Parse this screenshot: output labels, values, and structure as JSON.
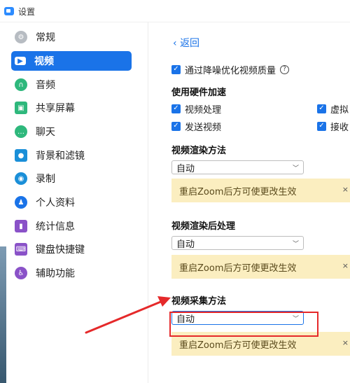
{
  "window": {
    "title": "设置"
  },
  "sidebar": {
    "items": [
      {
        "label": "常规",
        "icon": "gear-icon",
        "color": "#b7bcc2"
      },
      {
        "label": "视频",
        "icon": "video-camera-icon",
        "color": "#ffffff",
        "active": true
      },
      {
        "label": "音频",
        "icon": "headphones-icon",
        "color": "#2eb87c"
      },
      {
        "label": "共享屏幕",
        "icon": "share-screen-icon",
        "color": "#2eb87c"
      },
      {
        "label": "聊天",
        "icon": "chat-bubble-icon",
        "color": "#2eb87c"
      },
      {
        "label": "背景和滤镜",
        "icon": "portrait-icon",
        "color": "#1a8fd8"
      },
      {
        "label": "录制",
        "icon": "record-icon",
        "color": "#1a8fd8"
      },
      {
        "label": "个人资料",
        "icon": "user-icon",
        "color": "#1a73e8"
      },
      {
        "label": "统计信息",
        "icon": "bar-chart-icon",
        "color": "#8a52c8"
      },
      {
        "label": "键盘快捷键",
        "icon": "keyboard-icon",
        "color": "#8a52c8"
      },
      {
        "label": "辅助功能",
        "icon": "accessibility-icon",
        "color": "#8a52c8"
      }
    ]
  },
  "main": {
    "back_label": "返回",
    "denoise": {
      "label": "通过降噪优化视频质量",
      "checked": true
    },
    "hw_accel": {
      "title": "使用硬件加速",
      "options": [
        {
          "label": "视频处理",
          "checked": true
        },
        {
          "label": "虚拟",
          "checked": true
        },
        {
          "label": "发送视频",
          "checked": true
        },
        {
          "label": "接收",
          "checked": true
        }
      ]
    },
    "sections": [
      {
        "title": "视频渲染方法",
        "select_value": "自动",
        "notice": "重启Zoom后方可使更改生效"
      },
      {
        "title": "视频渲染后处理",
        "select_value": "自动",
        "notice": "重启Zoom后方可使更改生效"
      },
      {
        "title": "视频采集方法",
        "select_value": "自动",
        "notice": "重启Zoom后方可使更改生效"
      }
    ]
  },
  "colors": {
    "accent": "#1a73e8",
    "notice_bg": "#fbeec0",
    "annotation_red": "#e5292a"
  }
}
